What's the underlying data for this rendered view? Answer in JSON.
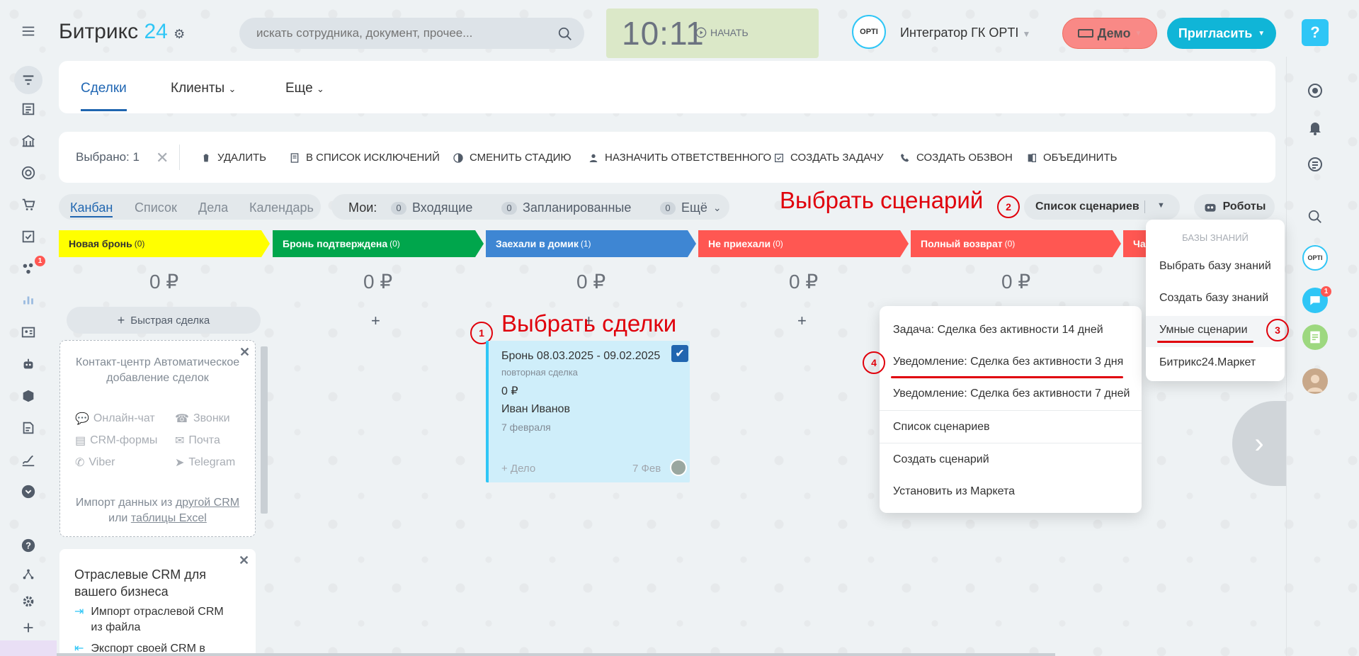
{
  "header": {
    "title_text": "Битрикс",
    "title_num": "24",
    "search_placeholder": "искать сотрудника, документ, прочее...",
    "clock_time": "10:11",
    "clock_start": "НАЧАТЬ",
    "org_logo": "OPTI",
    "org_name": "Интегратор ГК OPTI",
    "demo_label": "Демо",
    "invite_label": "Пригласить",
    "help_label": "?"
  },
  "leftbar": {
    "badge": "1"
  },
  "rightbar": {
    "chat_badge": "1",
    "logo_text": "OPTI"
  },
  "nav": {
    "tabs": [
      {
        "label": "Сделки"
      },
      {
        "label": "Клиенты"
      },
      {
        "label": "Еще"
      }
    ]
  },
  "actions": {
    "selected": "Выбрано: 1",
    "items": [
      "Удалить",
      "В список исключений",
      "Сменить стадию",
      "Назначить ответственного",
      "Создать задачу",
      "Создать обзвон",
      "Объединить"
    ]
  },
  "views": {
    "tabs": [
      "Канбан",
      "Список",
      "Дела",
      "Календарь"
    ]
  },
  "counters": {
    "label": "Мои:",
    "items": [
      {
        "n": "0",
        "label": "Входящие"
      },
      {
        "n": "0",
        "label": "Запланированные"
      },
      {
        "n": "0",
        "label": "Ещё"
      }
    ]
  },
  "annotations": {
    "choose_scenario": "Выбрать сценарий",
    "choose_deals": "Выбрать сделки",
    "n1": "1",
    "n2": "2",
    "n3": "3",
    "n4": "4"
  },
  "scenario_button": "Список сценариев",
  "robots_button": "Роботы",
  "stages": [
    {
      "name": "Новая бронь",
      "count": "(0)",
      "color": "#ffff00",
      "sum": "0 ₽"
    },
    {
      "name": "Бронь подтверждена",
      "count": "(0)",
      "color": "#00a64c",
      "sum": "0 ₽"
    },
    {
      "name": "Заехали в домик",
      "count": "(1)",
      "color": "#3e86d3",
      "sum": "0 ₽"
    },
    {
      "name": "Не приехали",
      "count": "(0)",
      "color": "#ff5752",
      "sum": "0 ₽"
    },
    {
      "name": "Полный возврат",
      "count": "(0)",
      "color": "#ff5752",
      "sum": "0 ₽"
    },
    {
      "name": "Ча",
      "count": "",
      "color": "#ff5752",
      "sum": ""
    }
  ],
  "quick_deal": "Быстрая сделка",
  "contact_center": {
    "title": "Контакт-центр Автоматическое добавление сделок",
    "channels": [
      "Онлайн-чат",
      "Звонки",
      "CRM-формы",
      "Почта",
      "Viber",
      "Telegram"
    ],
    "import_text": "Импорт данных из",
    "import_link1": "другой CRM",
    "import_or": "или",
    "import_link2": "таблицы Excel"
  },
  "industry": {
    "title": "Отраслевые CRM для вашего бизнеса",
    "items": [
      "Импорт отраслевой CRM из файла",
      "Экспорт своей CRM в"
    ]
  },
  "deal": {
    "title": "Бронь 08.03.2025 - 09.02.2025",
    "tag": "повторная сделка",
    "sum": "0 ₽",
    "client": "Иван Иванов",
    "date": "7 февраля",
    "add": "+ Дело",
    "short_date": "7 Фев"
  },
  "scenario_menu": [
    "Задача: Сделка без активности 14 дней",
    "Уведомление: Сделка без активности 3 дня",
    "Уведомление: Сделка без активности 7 дней",
    "Список сценариев",
    "Создать сценарий",
    "Установить из Маркета"
  ],
  "kb_menu": {
    "header": "Базы знаний",
    "items": [
      "Выбрать базу знаний",
      "Создать базу знаний",
      "Умные сценарии",
      "Битрикс24.Маркет"
    ]
  },
  "colors": {
    "accent": "#2fc6f6",
    "link": "#2066b0",
    "annotation": "#e0000b"
  }
}
